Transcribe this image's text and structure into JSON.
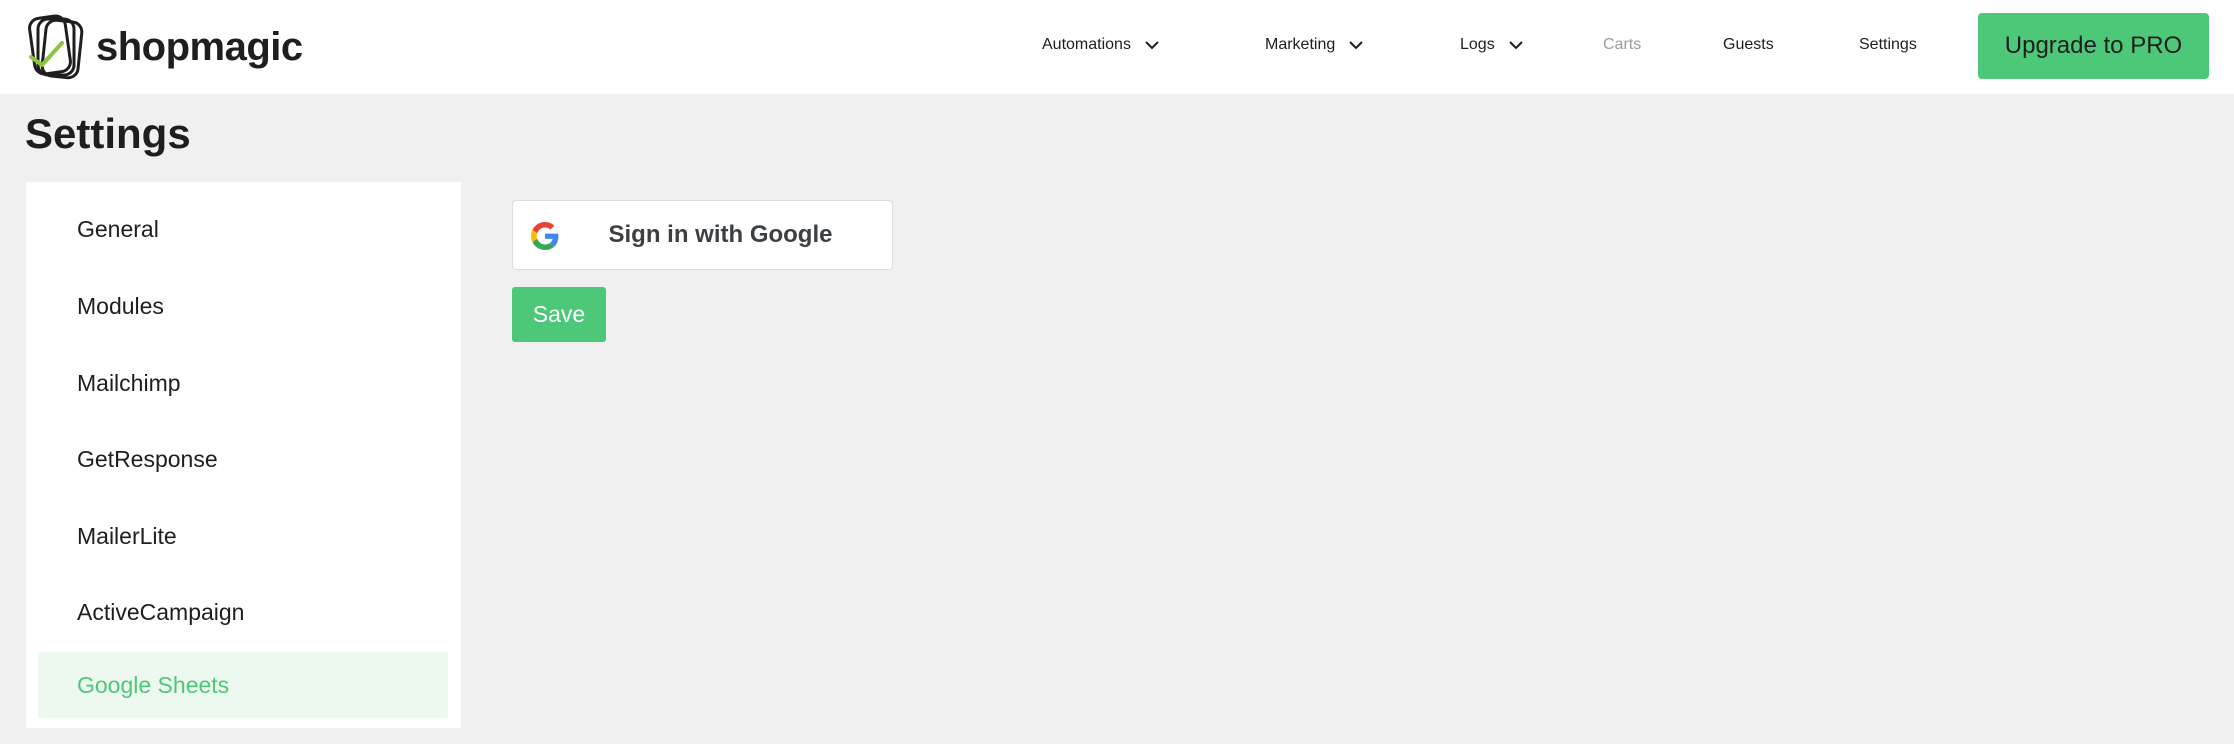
{
  "brand": {
    "name": "shopmagic",
    "logo_icon": "shopmagic-logo"
  },
  "nav": {
    "items": [
      {
        "label": "Automations",
        "has_dropdown": true
      },
      {
        "label": "Marketing",
        "has_dropdown": true
      },
      {
        "label": "Logs",
        "has_dropdown": true
      },
      {
        "label": "Carts",
        "disabled": true
      },
      {
        "label": "Guests"
      },
      {
        "label": "Settings"
      }
    ],
    "upgrade_label": "Upgrade to PRO"
  },
  "page": {
    "title": "Settings"
  },
  "sidebar": {
    "items": [
      {
        "label": "General"
      },
      {
        "label": "Modules"
      },
      {
        "label": "Mailchimp"
      },
      {
        "label": "GetResponse"
      },
      {
        "label": "MailerLite"
      },
      {
        "label": "ActiveCampaign"
      },
      {
        "label": "Google Sheets",
        "active": true
      }
    ]
  },
  "main": {
    "google_signin_label": "Sign in with Google",
    "save_label": "Save"
  },
  "colors": {
    "accent": "#4dc879",
    "active_bg": "#edf8ef",
    "page_bg": "#f0f0f0",
    "muted_text": "#9a9a9a"
  }
}
